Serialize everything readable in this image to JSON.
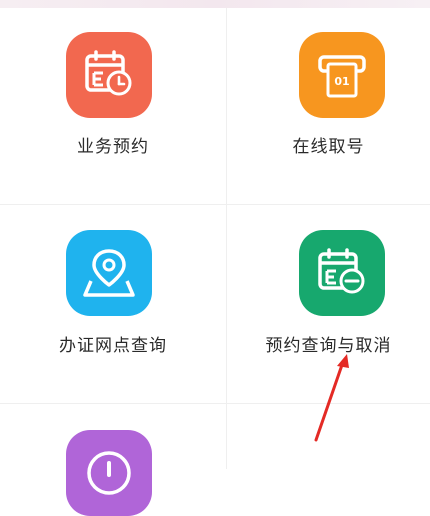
{
  "services": [
    {
      "label": "业务预约",
      "icon": "calendar-clock-icon",
      "color": "#f2684f"
    },
    {
      "label": "在线取号",
      "icon": "ticket-number-icon",
      "color": "#f7961f",
      "ticket_text": "01"
    },
    {
      "label": "办证网点查询",
      "icon": "map-location-icon",
      "color": "#1fb3ee"
    },
    {
      "label": "预约查询与取消",
      "icon": "calendar-cancel-icon",
      "color": "#17a86e"
    },
    {
      "label": "",
      "icon": "info-icon",
      "color": "#b065d8"
    }
  ],
  "colors": {
    "annotation_arrow": "#e42a25",
    "divider": "#efefef"
  }
}
